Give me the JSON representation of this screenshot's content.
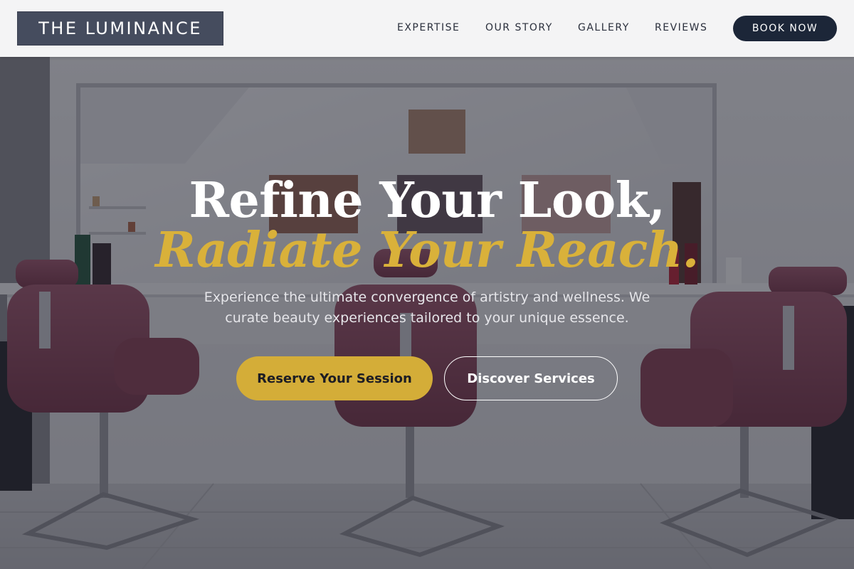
{
  "brand": {
    "name": "THE LUMINANCE"
  },
  "nav": {
    "links": [
      "EXPERTISE",
      "OUR STORY",
      "GALLERY",
      "REVIEWS"
    ],
    "cta": "BOOK NOW"
  },
  "hero": {
    "headline_line1": "Refine Your Look,",
    "headline_line2": "Radiate Your Reach.",
    "subtext": "Experience the ultimate convergence of artistry and wellness. We curate beauty experiences tailored to your unique essence.",
    "primary_cta": "Reserve Your Session",
    "secondary_cta": "Discover Services"
  },
  "colors": {
    "header_bg": "#f4f4f5",
    "logo_bg": "#454c5e",
    "book_button_bg": "#1c2638",
    "accent_gold": "#d4ad38",
    "chair_upholstery": "#8e4a5e"
  }
}
